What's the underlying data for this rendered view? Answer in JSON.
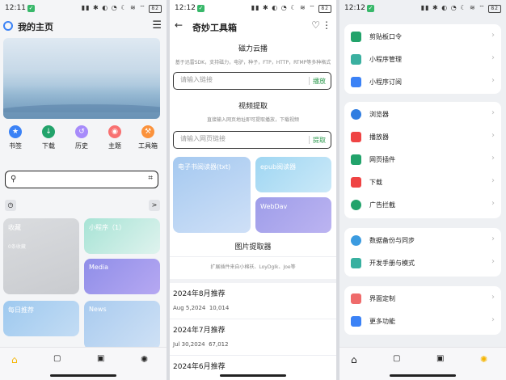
{
  "status": [
    {
      "time": "12:11",
      "battery": "82"
    },
    {
      "time": "12:12",
      "battery": "82"
    },
    {
      "time": "12:12",
      "battery": "82"
    }
  ],
  "home": {
    "title": "我的主页",
    "quick": [
      {
        "label": "书签",
        "color": "#3b82f6",
        "glyph": "★"
      },
      {
        "label": "下载",
        "color": "#22a36b",
        "glyph": "↓"
      },
      {
        "label": "历史",
        "color": "#a78bfa",
        "glyph": "↺"
      },
      {
        "label": "主题",
        "color": "#f87171",
        "glyph": "◉"
      },
      {
        "label": "工具箱",
        "color": "#fb923c",
        "glyph": "⚒"
      }
    ],
    "history_arrow": ">",
    "tiles": {
      "fav": {
        "label": "收藏",
        "sub": "0条收藏"
      },
      "mini": {
        "label": "小程序（1）"
      },
      "media": {
        "label": "Media"
      },
      "daily": {
        "label": "每日推荐"
      },
      "news": {
        "label": "News"
      }
    }
  },
  "toolbox": {
    "title": "奇妙工具箱",
    "magnet": {
      "title": "磁力云播",
      "sub": "基于迅雷SDK，支持磁力，电驴，种子，FTP，HTTP，RTMP等多种格式",
      "placeholder": "请输入链接",
      "action": "播放"
    },
    "video": {
      "title": "视频提取",
      "sub": "直接输入网页地址即可提取播放，下载视频",
      "placeholder": "请输入网页链接",
      "action": "提取"
    },
    "cards": {
      "ebook": "电子书阅读器(txt)",
      "epub": "epub阅读器",
      "webdav": "WebDav"
    },
    "image": {
      "title": "图片提取器",
      "sub": "扩展插件来自小棉袄、LoyDgIk、Joe等"
    },
    "months": [
      {
        "title": "2024年8月推荐",
        "date": "Aug 5,2024",
        "count": "10,014"
      },
      {
        "title": "2024年7月推荐",
        "date": "Jul 30,2024",
        "count": "67,012"
      },
      {
        "title": "2024年6月推荐"
      }
    ]
  },
  "settings": {
    "group1": [
      {
        "label": "剪贴板口令",
        "icon": "clipboard-icon",
        "color": "#22a36b"
      },
      {
        "label": "小程序管理",
        "icon": "grid-icon",
        "color": "#3bb0a0"
      },
      {
        "label": "小程序订阅",
        "icon": "subscribe-icon",
        "color": "#3b82f6"
      }
    ],
    "group2": [
      {
        "label": "浏览器",
        "icon": "browser-icon",
        "color": "#2f7de1"
      },
      {
        "label": "播放器",
        "icon": "play-icon",
        "color": "#ef4444"
      },
      {
        "label": "网页插件",
        "icon": "puzzle-icon",
        "color": "#22a36b"
      },
      {
        "label": "下载",
        "icon": "download-icon",
        "color": "#ef4444"
      },
      {
        "label": "广告拦截",
        "icon": "shield-icon",
        "color": "#22a36b"
      }
    ],
    "group3": [
      {
        "label": "数据备份与同步",
        "icon": "cloud-icon",
        "color": "#3b9be0"
      },
      {
        "label": "开发手册与模式",
        "icon": "help-icon",
        "color": "#38b0a0"
      }
    ],
    "group4": [
      {
        "label": "界面定制",
        "icon": "layout-icon",
        "color": "#ef6b6b"
      },
      {
        "label": "更多功能",
        "icon": "more-icon",
        "color": "#3b82f6"
      }
    ]
  }
}
